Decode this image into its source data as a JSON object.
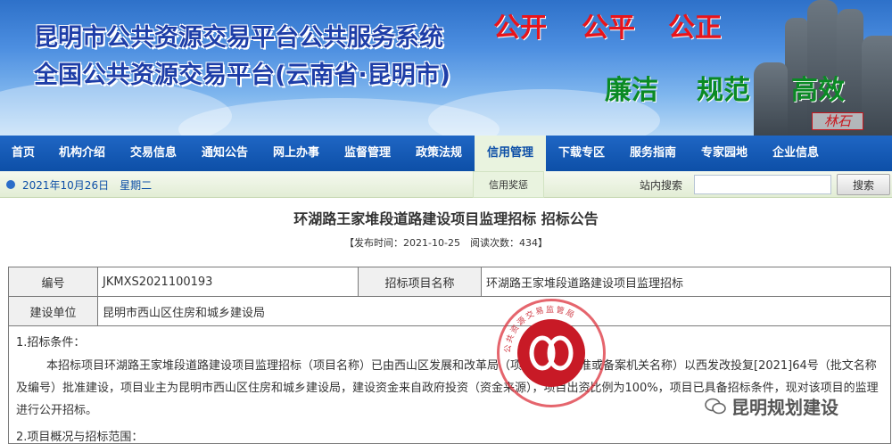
{
  "banner": {
    "title_line1": "昆明市公共资源交易平台公共服务系统",
    "title_line2": "全国公共资源交易平台(云南省·昆明市)",
    "slogans_top": [
      "公开",
      "公平",
      "公正"
    ],
    "slogans_bottom": [
      "廉洁",
      "规范",
      "高效"
    ],
    "stone_seal": "林石"
  },
  "nav": {
    "items": [
      "首页",
      "机构介绍",
      "交易信息",
      "通知公告",
      "网上办事",
      "监督管理",
      "政策法规",
      "信用管理",
      "下载专区",
      "服务指南",
      "专家园地",
      "企业信息"
    ],
    "active_index": 7,
    "sub_item": "信用奖惩"
  },
  "infobar": {
    "date": "2021年10月26日　星期二",
    "search_label": "站内搜索",
    "search_value": "",
    "search_button": "搜索"
  },
  "article": {
    "title": "环湖路王家堆段道路建设项目监理招标 招标公告",
    "meta": "【发布时间：2021-10-25　阅读次数：434】",
    "table": {
      "r1": [
        "编号",
        "JKMXS2021100193",
        "招标项目名称",
        "环湖路王家堆段道路建设项目监理招标"
      ],
      "r2": [
        "建设单位",
        "昆明市西山区住房和城乡建设局"
      ]
    },
    "section1": "1.招标条件：",
    "para1": "本招标项目环湖路王家堆段道路建设项目监理招标（项目名称）已由西山区发展和改革局（项目审批、核准或备案机关名称）以西发改投复[2021]64号（批文名称及编号）批准建设，项目业主为昆明市西山区住房和城乡建设局，建设资金来自政府投资（资金来源），项目出资比例为100%，项目已具备招标条件，现对该项目的监理进行公开招标。",
    "section2": "2.项目概况与招标范围："
  },
  "seal": {
    "ring_text": "公共资源交易监管局"
  },
  "watermark": {
    "text": "昆明规划建设"
  },
  "colors": {
    "nav_bg": "#0d4fa7",
    "title_blue": "#1e3ea8",
    "slogan_red": "#e8141b",
    "slogan_green": "#0a8a24",
    "seal_red": "#c81a26"
  }
}
